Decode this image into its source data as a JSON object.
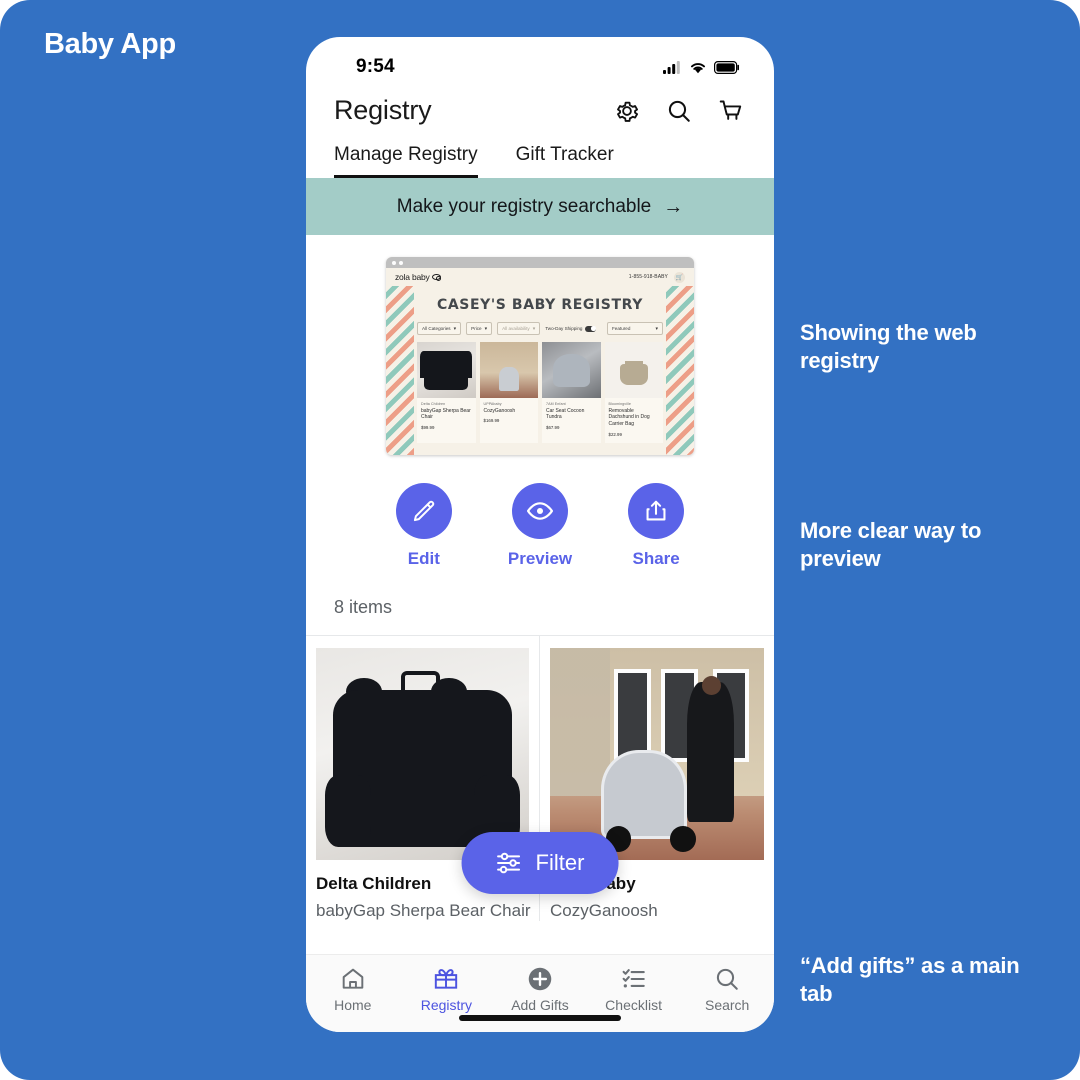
{
  "slide": {
    "title": "Baby App",
    "background_color": "#3371C3"
  },
  "annotations": [
    {
      "text": "Showing the web registry"
    },
    {
      "text": "More clear way to preview"
    },
    {
      "text": "“Add gifts” as a main tab"
    }
  ],
  "phone": {
    "status_bar": {
      "time": "9:54",
      "icons": [
        "cellular-signal-icon",
        "wifi-icon",
        "battery-icon"
      ]
    },
    "nav": {
      "title": "Registry",
      "actions": [
        {
          "name": "settings",
          "icon": "gear-icon"
        },
        {
          "name": "search",
          "icon": "search-icon"
        },
        {
          "name": "cart",
          "icon": "cart-icon"
        }
      ]
    },
    "tabs": [
      {
        "label": "Manage Registry",
        "active": true
      },
      {
        "label": "Gift Tracker",
        "active": false
      }
    ],
    "banner": {
      "text": "Make your registry searchable",
      "arrow": "→",
      "color": "#A3CCC7"
    },
    "web_preview": {
      "logo": "zola baby",
      "phone_number": "1-855-918-BABY",
      "page_title": "CASEY'S BABY REGISTRY",
      "filters": [
        {
          "label": "All Categories",
          "type": "dropdown"
        },
        {
          "label": "Price",
          "type": "dropdown"
        },
        {
          "label": "All availability",
          "type": "dropdown",
          "muted": true
        },
        {
          "label": "Two-Day Shipping",
          "type": "toggle"
        }
      ],
      "sort": {
        "label": "Featured"
      },
      "products": [
        {
          "brand": "Delta Children",
          "name": "babyGap Sherpa Bear Chair",
          "price": "$99.99",
          "art": "art-chair"
        },
        {
          "brand": "UPPAbaby",
          "name": "CozyGanoosh",
          "price": "$169.99",
          "art": "art-stroller"
        },
        {
          "brand": "7AM Enfant",
          "name": "Car Seat Cocoon Tundra",
          "price": "$67.99",
          "art": "art-carseat"
        },
        {
          "brand": "Bloomingville",
          "name": "Removable Dachshund in Dog Carrier Bag",
          "price": "$22.99",
          "art": "art-bag"
        }
      ]
    },
    "actions": [
      {
        "label": "Edit",
        "icon": "pencil-icon"
      },
      {
        "label": "Preview",
        "icon": "eye-icon"
      },
      {
        "label": "Share",
        "icon": "share-icon"
      }
    ],
    "items_count": "8 items",
    "product_cards": [
      {
        "brand": "Delta Children",
        "name": "babyGap Sherpa Bear Chair"
      },
      {
        "brand": "UPPAbaby",
        "name": "CozyGanoosh"
      }
    ],
    "filter_button": {
      "label": "Filter",
      "icon": "sliders-icon"
    },
    "tab_bar": [
      {
        "label": "Home",
        "icon": "home-icon",
        "active": false
      },
      {
        "label": "Registry",
        "icon": "gift-icon",
        "active": true
      },
      {
        "label": "Add Gifts",
        "icon": "plus-circle-icon",
        "active": false
      },
      {
        "label": "Checklist",
        "icon": "checklist-icon",
        "active": false
      },
      {
        "label": "Search",
        "icon": "search-icon",
        "active": false
      }
    ]
  },
  "colors": {
    "accent_purple": "#5A63E8",
    "banner_green": "#A3CCC7",
    "slide_blue": "#3371C3"
  }
}
